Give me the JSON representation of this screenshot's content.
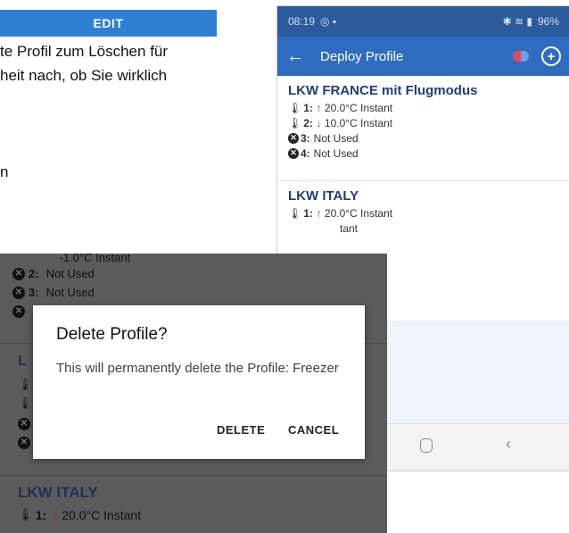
{
  "document": {
    "edit_button": "EDIT",
    "line1": "te Profil zum Löschen für",
    "line2": "heit nach, ob Sie wirklich",
    "line3": "n"
  },
  "phone_right": {
    "status": {
      "time": "08:19",
      "right": "96%"
    },
    "appbar": {
      "title": "Deploy Profile"
    },
    "profiles": [
      {
        "name": "LKW FRANCE mit Flugmodus",
        "channels": [
          {
            "num": "1:",
            "dir": "up",
            "text": "20.0°C Instant"
          },
          {
            "num": "2:",
            "dir": "down",
            "text": "10.0°C Instant"
          },
          {
            "num": "3:",
            "dir": "none",
            "text": "Not Used"
          },
          {
            "num": "4:",
            "dir": "none",
            "text": "Not Used"
          }
        ]
      },
      {
        "name": "LKW ITALY",
        "channels": [
          {
            "num": "1:",
            "dir": "up",
            "text": "20.0°C Instant"
          },
          {
            "num": "",
            "dir": "none",
            "text": "tant"
          }
        ]
      }
    ]
  },
  "phone_left": {
    "top_partial": "-1.0°C Instant",
    "rows": [
      {
        "num": "2:",
        "text": "Not Used"
      },
      {
        "num": "3:",
        "text": "Not Used"
      }
    ],
    "behind_initial": "L",
    "dialog": {
      "title": "Delete Profile?",
      "message": "This will permanently delete the Profile: Freezer",
      "delete": "DELETE",
      "cancel": "CANCEL"
    },
    "bottom_profile": {
      "name": "LKW ITALY",
      "num": "1:",
      "text": "20.0°C Instant"
    }
  }
}
